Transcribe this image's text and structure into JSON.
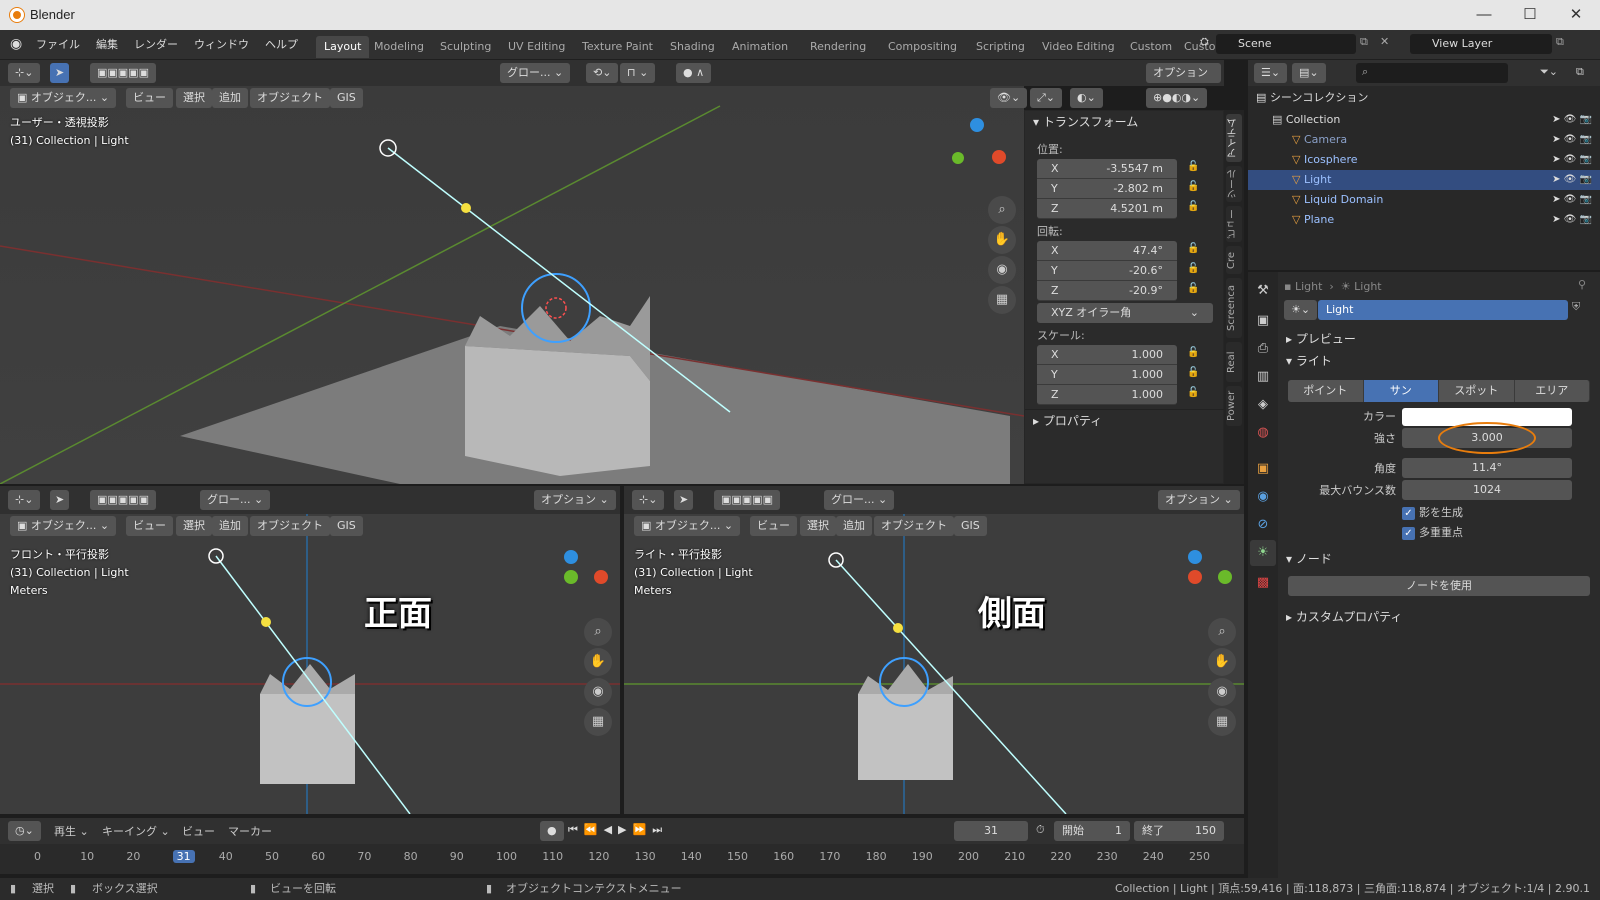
{
  "app": {
    "title": "Blender",
    "status_right": "Collection | Light | 頂点:59,416 | 面:118,873 | 三角面:118,874 | オブジェクト:1/4 | 2.90.1"
  },
  "menu": [
    "ファイル",
    "編集",
    "レンダー",
    "ウィンドウ",
    "ヘルプ"
  ],
  "workspace_tabs": [
    "Layout",
    "Modeling",
    "Sculpting",
    "UV Editing",
    "Texture Paint",
    "Shading",
    "Animation",
    "Rendering",
    "Compositing",
    "Scripting",
    "Video Editing",
    "Custom",
    "Custon"
  ],
  "active_tab": "Layout",
  "scene": {
    "name": "Scene",
    "view_layer": "View Layer"
  },
  "viewport_header": {
    "mode": "オブジェク...",
    "view": "ビュー",
    "select": "選択",
    "add": "追加",
    "object": "オブジェクト",
    "gis": "GIS",
    "transform": "グロー...",
    "options": "オプション"
  },
  "main_view": {
    "projection": "ユーザー・透視投影",
    "context": "(31) Collection | Light"
  },
  "front_view": {
    "projection": "フロント・平行投影",
    "context": "(31) Collection | Light",
    "units": "Meters",
    "caption": "正面"
  },
  "right_view": {
    "projection": "ライト・平行投影",
    "context": "(31) Collection | Light",
    "units": "Meters",
    "caption": "側面"
  },
  "npanel": {
    "transform_title": "トランスフォーム",
    "location_label": "位置:",
    "location": [
      {
        "axis": "X",
        "value": "-3.5547 m"
      },
      {
        "axis": "Y",
        "value": "-2.802 m"
      },
      {
        "axis": "Z",
        "value": "4.5201 m"
      }
    ],
    "rotation_label": "回転:",
    "rotation": [
      {
        "axis": "X",
        "value": "47.4°"
      },
      {
        "axis": "Y",
        "value": "-20.6°"
      },
      {
        "axis": "Z",
        "value": "-20.9°"
      }
    ],
    "rotation_mode": "XYZ オイラー角",
    "scale_label": "スケール:",
    "scale": [
      {
        "axis": "X",
        "value": "1.000"
      },
      {
        "axis": "Y",
        "value": "1.000"
      },
      {
        "axis": "Z",
        "value": "1.000"
      }
    ],
    "properties_title": "プロパティ",
    "side_tabs": [
      "アイテム",
      "ツール",
      "ビュー",
      "Cre",
      "Screenca",
      "Real",
      "Power"
    ]
  },
  "outliner": {
    "scene_collection": "シーンコレクション",
    "items": [
      {
        "name": "Collection",
        "indent": 0,
        "selected": false
      },
      {
        "name": "Camera",
        "indent": 1,
        "selected": false
      },
      {
        "name": "Icosphere",
        "indent": 1,
        "selected": false
      },
      {
        "name": "Light",
        "indent": 1,
        "selected": true
      },
      {
        "name": "Liquid Domain",
        "indent": 1,
        "selected": false
      },
      {
        "name": "Plane",
        "indent": 1,
        "selected": false
      }
    ]
  },
  "properties": {
    "breadcrumb_obj": "Light",
    "breadcrumb_data": "Light",
    "data_name": "Light",
    "preview": "プレビュー",
    "light_section": "ライト",
    "light_types": [
      "ポイント",
      "サン",
      "スポット",
      "エリア"
    ],
    "active_light_type": "サン",
    "color_label": "カラー",
    "strength_label": "強さ",
    "strength": "3.000",
    "angle_label": "角度",
    "angle": "11.4°",
    "max_bounces_label": "最大バウンス数",
    "max_bounces": "1024",
    "shadow_label": "影を生成",
    "multi_importance_label": "多重重点",
    "nodes_section": "ノード",
    "use_nodes": "ノードを使用",
    "custom_props": "カスタムプロパティ",
    "highlight_color": "#e87d0d"
  },
  "timeline": {
    "playback": "再生",
    "keying": "キーイング",
    "view": "ビュー",
    "marker": "マーカー",
    "current_frame": "31",
    "start_label": "開始",
    "start": "1",
    "end_label": "終了",
    "end": "150",
    "ticks": [
      "0",
      "10",
      "20",
      "31",
      "40",
      "50",
      "60",
      "70",
      "80",
      "90",
      "100",
      "110",
      "120",
      "130",
      "140",
      "150",
      "160",
      "170",
      "180",
      "190",
      "200",
      "210",
      "220",
      "230",
      "240",
      "250"
    ]
  },
  "statusbar": {
    "select": "選択",
    "box_select": "ボックス選択",
    "rotate_view": "ビューを回転",
    "context_menu": "オブジェクトコンテクストメニュー"
  }
}
